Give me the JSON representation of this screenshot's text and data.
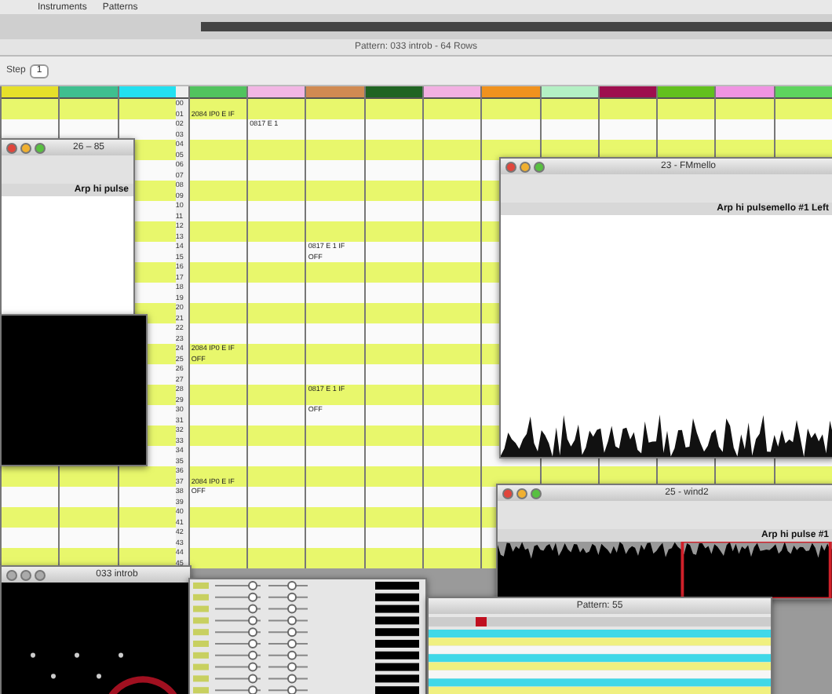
{
  "menu": [
    {
      "label": "Instruments"
    },
    {
      "label": "Patterns"
    }
  ],
  "pattern_window": {
    "title": "Pattern: 033 introb - 64 Rows",
    "step_label": "Step",
    "step": "1",
    "channels": [
      {
        "color": "#e6e02a"
      },
      {
        "color": "#3fbf8f"
      },
      {
        "color": "#22e0f0"
      },
      {
        "color": "#52c35e",
        "notes": [
          "2084 IP0 E IF",
          "2084 IP0 E IF",
          "OFF",
          "2084 IP0 E IF",
          "OFF"
        ]
      },
      {
        "color": "#f2b6e4",
        "notes": [
          "0817 E 1"
        ]
      },
      {
        "color": "#d08a52",
        "notes": [
          "0817 E 1 IF",
          "OFF",
          "0817 E 1 IF",
          "OFF"
        ]
      },
      {
        "color": "#1f6422"
      },
      {
        "color": "#f2b0e2"
      },
      {
        "color": "#f0921e"
      },
      {
        "color": "#b4f0c4"
      },
      {
        "color": "#9e0f4e"
      },
      {
        "color": "#62c01e"
      },
      {
        "color": "#f094e2"
      },
      {
        "color": "#5ed45e"
      }
    ],
    "row_numbers": [
      "00",
      "01",
      "02",
      "03",
      "04",
      "05",
      "06",
      "07",
      "08",
      "09",
      "10",
      "11",
      "12",
      "13",
      "14",
      "15",
      "16",
      "17",
      "18",
      "19",
      "20",
      "21",
      "22",
      "23",
      "24",
      "25",
      "26",
      "27",
      "28",
      "29",
      "30",
      "31",
      "32",
      "33",
      "34",
      "35",
      "36",
      "37",
      "38",
      "39",
      "40",
      "41",
      "42",
      "43",
      "44",
      "45"
    ]
  },
  "sample_windows": [
    {
      "kind": "plain",
      "title": "26 – 85",
      "caption": "Arp hi pulse"
    },
    {
      "kind": "band",
      "title": "23 - FMmello",
      "caption": "Arp hi pulsemello #1 Left"
    },
    {
      "kind": "selection",
      "title": "25 - wind2",
      "caption": "Arp hi pulse #1"
    }
  ],
  "bottom": {
    "song_window_title": "033 introb",
    "pattern_title": "Pattern: 55"
  }
}
